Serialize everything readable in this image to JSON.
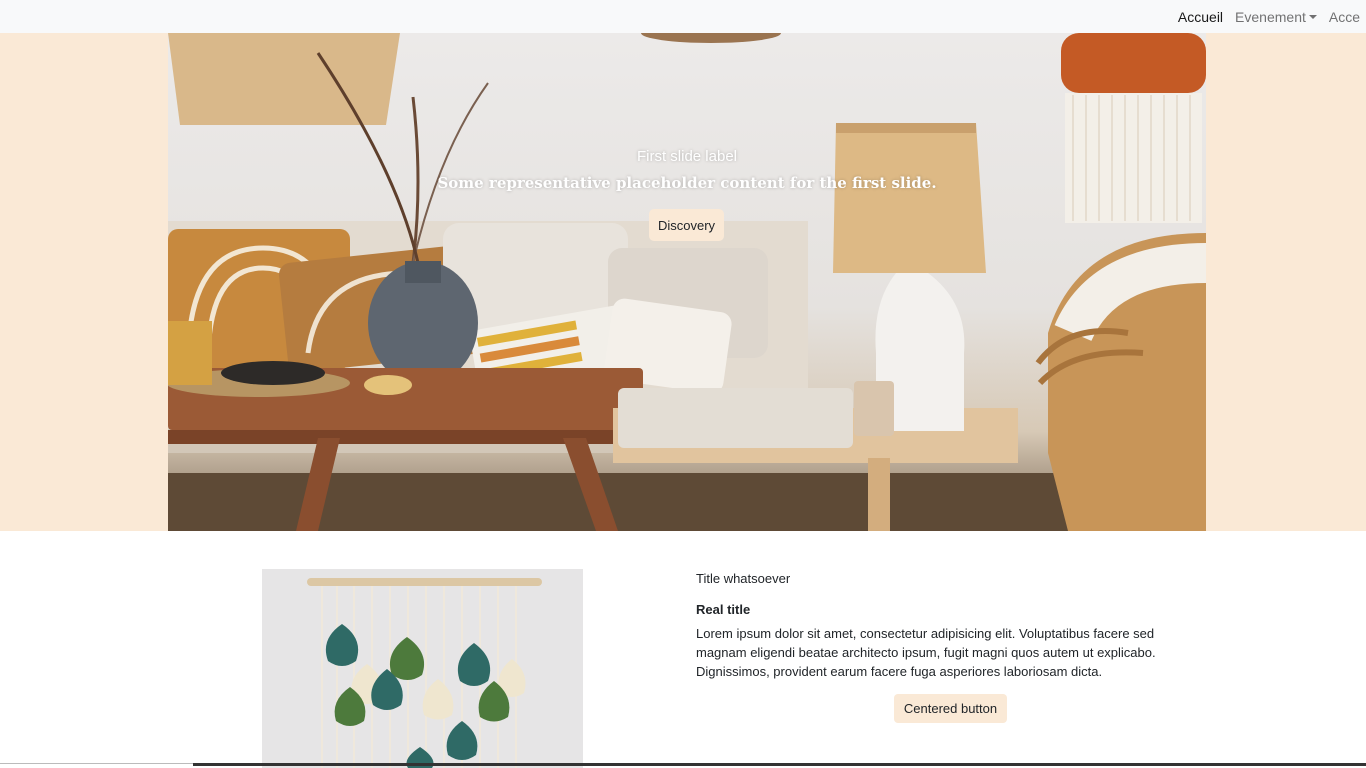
{
  "nav": {
    "items": [
      {
        "label": "Accueil",
        "active": true
      },
      {
        "label": "Evenement",
        "dropdown": true
      },
      {
        "label": "Acce"
      }
    ]
  },
  "carousel": {
    "slide_title": "First slide label",
    "slide_text": "Some representative placeholder content for the first slide.",
    "button_label": "Discovery"
  },
  "feature": {
    "subtitle": "Title whatsoever",
    "title": "Real title",
    "body": "Lorem ipsum dolor sit amet, consectetur adipisicing elit. Voluptatibus facere sed magnam eligendi beatae architecto ipsum, fugit magni quos autem ut explicabo. Dignissimos, provident earum facere fuga asperiores laboriosam dicta.",
    "button_label": "Centered button"
  },
  "colors": {
    "accent_beige": "#fae9d6",
    "navbar_bg": "#f8f9fa"
  }
}
